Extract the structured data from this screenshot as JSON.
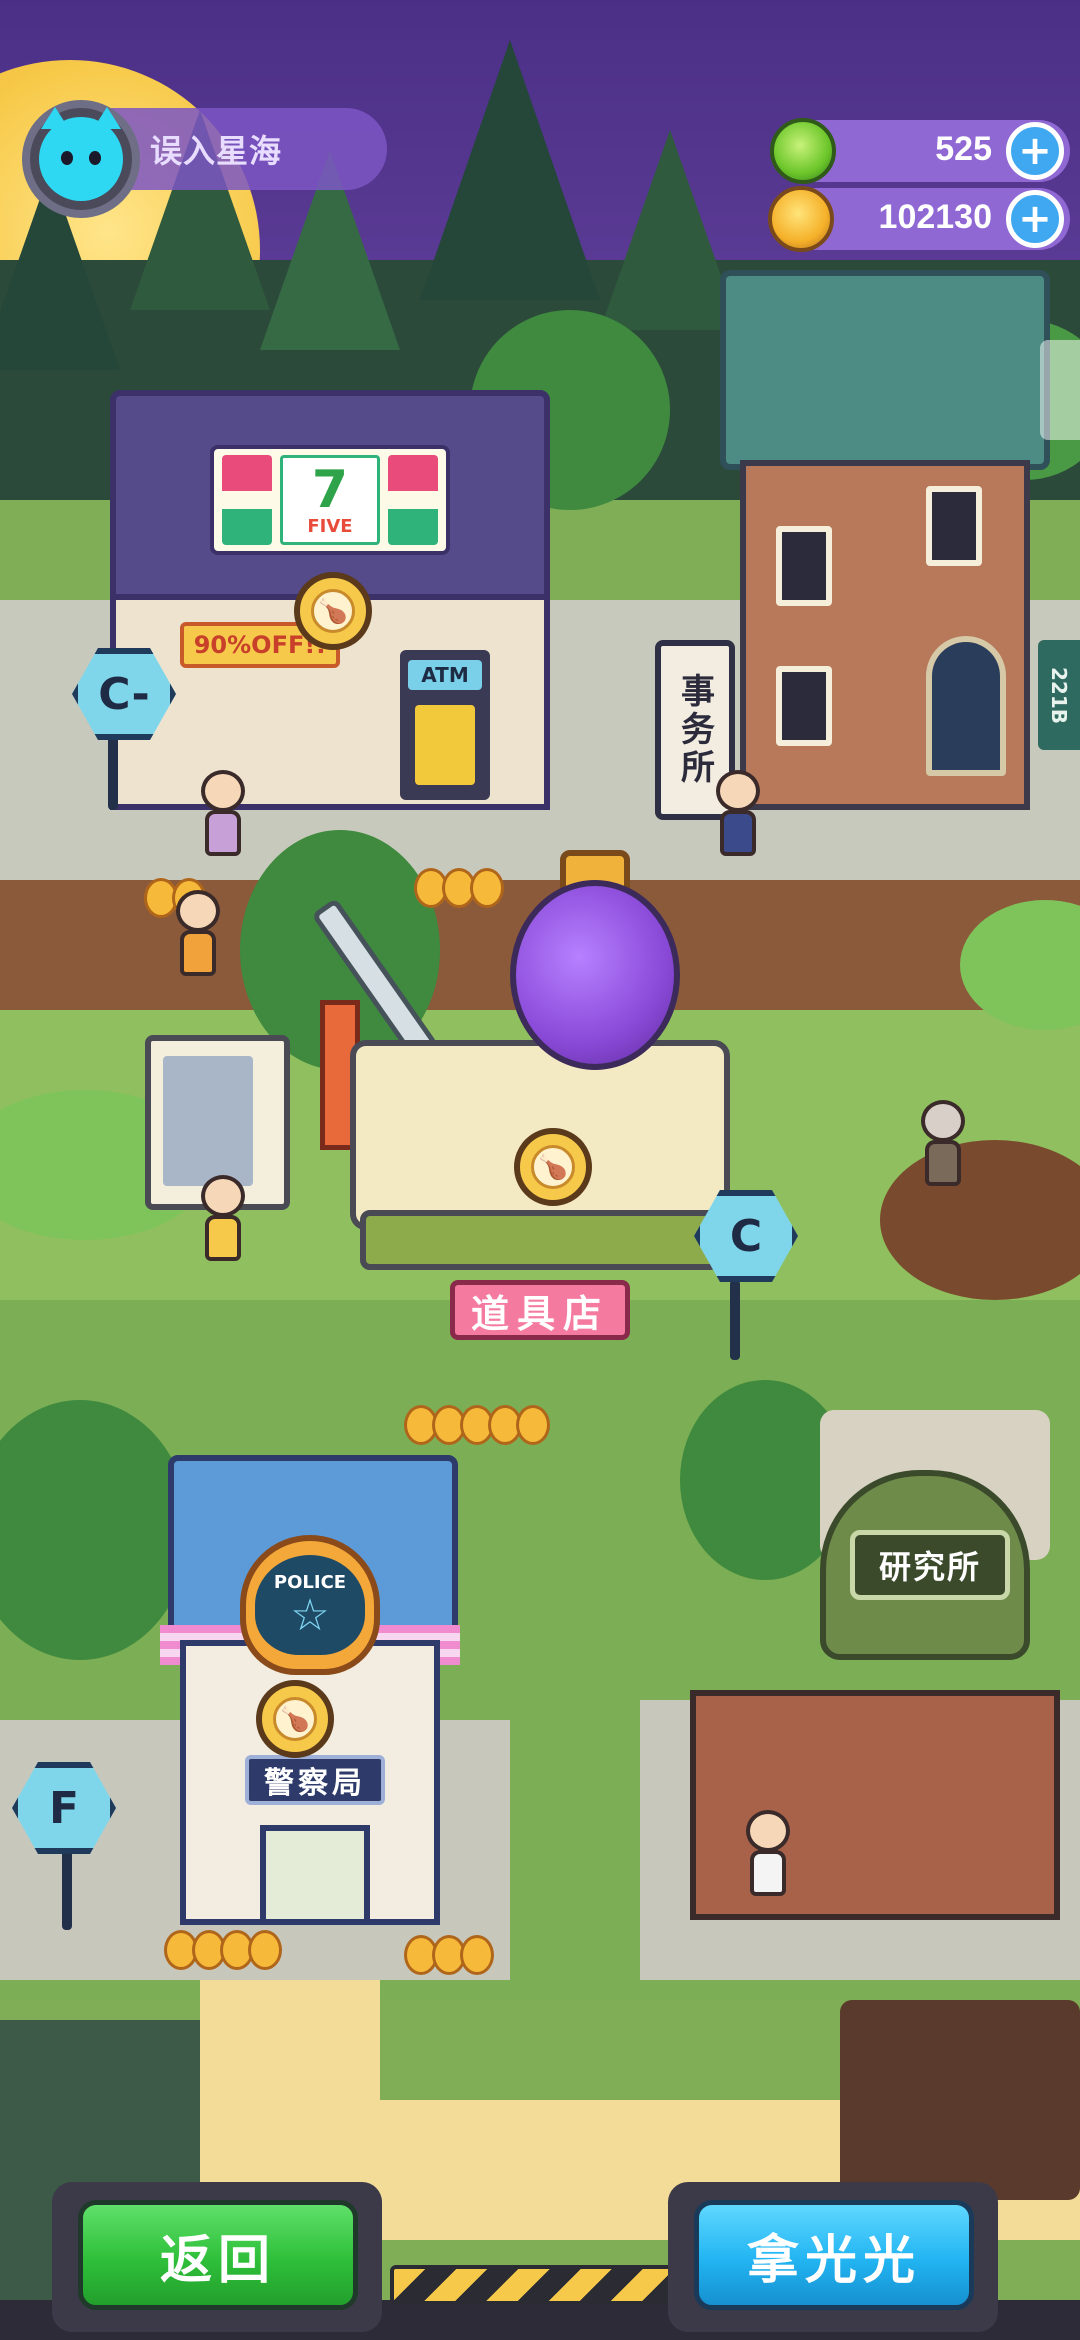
{
  "hud": {
    "player_name": "误入星海",
    "avatar_icon": "cat-avatar-icon",
    "currencies": [
      {
        "name": "gem",
        "icon": "green-gem-icon",
        "value": "525"
      },
      {
        "name": "coin",
        "icon": "gold-coin-icon",
        "value": "102130"
      }
    ],
    "plus_label": "+"
  },
  "buildings": {
    "convenience_store": {
      "logo_number": "7",
      "logo_text": "FIVE",
      "sale_banner": "90%OFF!!",
      "atm_label": "ATM",
      "grade": "C-"
    },
    "detective_office": {
      "sign": "事务所",
      "plaque": "221B"
    },
    "item_shop": {
      "sign": "道具店",
      "grade": "C"
    },
    "police_station": {
      "badge_text": "POLICE",
      "sign": "警察局",
      "grade": "F"
    },
    "research_lab": {
      "sign": "研究所"
    }
  },
  "buttons": {
    "back": "返回",
    "take_all": "拿光光"
  },
  "colors": {
    "back_button": "#2fbf3a",
    "take_button": "#22b4f2",
    "grade_marker": "#7fd6ea",
    "hud_pill": "#7c56c4"
  }
}
